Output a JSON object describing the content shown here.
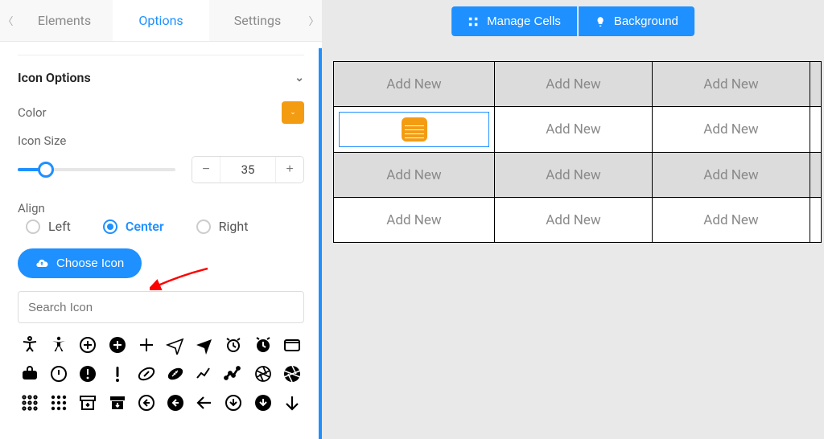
{
  "tabs": {
    "elements": "Elements",
    "options": "Options",
    "settings": "Settings"
  },
  "section": {
    "title": "Icon Options",
    "color_label": "Color",
    "color_value": "#f39c12",
    "size_label": "Icon Size",
    "size_value": "35",
    "align_label": "Align",
    "align_left": "Left",
    "align_center": "Center",
    "align_right": "Right",
    "align_selected": "center",
    "choose_label": "Choose Icon",
    "search_placeholder": "Search Icon"
  },
  "top_buttons": {
    "manage": "Manage Cells",
    "background": "Background"
  },
  "table": {
    "cell_label": "Add New",
    "rows": 4,
    "cols": 3
  },
  "icons": {
    "row1": [
      "accessibility-outline",
      "accessibility",
      "plus-circle-outline",
      "plus-circle",
      "plus",
      "airplane-outline",
      "airplane",
      "alarm-outline",
      "alarm",
      "tablet-outline"
    ],
    "row2": [
      "suitcase",
      "alert-circle-outline",
      "alert-circle",
      "exclaim",
      "football-outline",
      "football",
      "analytics-outline",
      "analytics",
      "aperture-outline",
      "aperture"
    ],
    "row3": [
      "dots-grid",
      "dots-grid-filled",
      "archive-outline",
      "archive",
      "arrow-back-circle-outline",
      "arrow-back-circle",
      "arrow-back",
      "arrow-down-circle-outline",
      "arrow-down-circle",
      "arrow-down"
    ]
  }
}
